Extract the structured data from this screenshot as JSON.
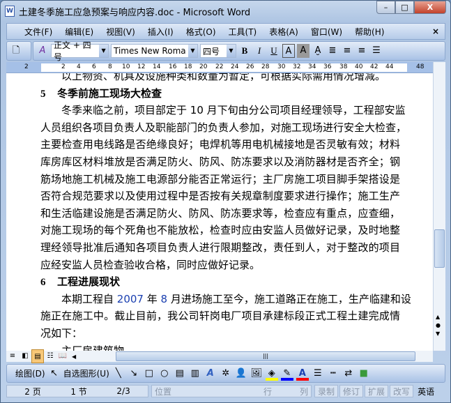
{
  "window": {
    "title": "土建冬季施工应急预案与响应内容.doc - Microsoft Word",
    "app_icon": "W",
    "minimize": "–",
    "maximize": "□",
    "close": "X"
  },
  "menu": {
    "items": [
      "文件(F)",
      "编辑(E)",
      "视图(V)",
      "插入(I)",
      "格式(O)",
      "工具(T)",
      "表格(A)",
      "窗口(W)",
      "帮助(H)"
    ],
    "close": "×"
  },
  "format_toolbar": {
    "style": "正文 + 四号",
    "font": "Times New Roma",
    "size": "四号",
    "bold": "B",
    "italic": "I",
    "underline": "U"
  },
  "ruler": {
    "ticks": [
      "2",
      "2",
      "4",
      "6",
      "8",
      "10",
      "12",
      "14",
      "16",
      "18",
      "20",
      "22",
      "24",
      "26",
      "28",
      "30",
      "32",
      "34",
      "36",
      "38",
      "40",
      "42",
      "44",
      "48"
    ]
  },
  "document": {
    "lines": [
      {
        "text": "以上物资、机具及设施种类和数量为暂定，可根据实际需用情况增减。",
        "type": "partial"
      },
      {
        "num": "5",
        "text": "冬季前施工现场大检查",
        "type": "heading"
      },
      {
        "text": "　　冬季来临之前，项目部定于 10 月下旬由分公司项目经理领导，工程部安监"
      },
      {
        "text": "人员组织各项目负责人及职能部门的负责人参加，对施工现场进行安全大检查，"
      },
      {
        "text": "主要检查用电线路是否绝缘良好；电焊机等用电机械接地是否灵敏有效；材料"
      },
      {
        "text": "库房库区材料堆放是否满足防火、防风、防冻要求以及消防器材是否齐全；钢"
      },
      {
        "text": "筋场地施工机械及施工电源部分能否正常运行；主厂房施工项目脚手架搭设是"
      },
      {
        "text": "否符合规范要求以及使用过程中是否按有关规章制度要求进行操作；施工生产"
      },
      {
        "text": "和生活临建设施是否满足防火、防风、防冻要求等，检查应有重点，应查细，"
      },
      {
        "text": "对施工现场的每个死角也不能放松，检查时应由安监人员做好记录，及时地整"
      },
      {
        "text": "理经领导批准后通知各项目负责人进行限期整改，责任到人，对于整改的项目"
      },
      {
        "text": "应经安监人员检查验收合格，同时应做好记录。",
        "type": "last"
      },
      {
        "num": "6",
        "text": "工程进展现状",
        "type": "heading"
      },
      {
        "pre": "　　本期工程自 ",
        "year": "2007",
        "mid": " 年 ",
        "month": "8",
        "post": " 月进场施工至今，施工道路正在施工，生产临建和设",
        "type": "mixed"
      },
      {
        "text": "施正在施工中。截止目前，我公司轩岗电厂项目承建标段正式工程土建完成情"
      },
      {
        "text": "况如下：",
        "type": "last"
      },
      {
        "text": "　　主厂房建筑物",
        "type": "last"
      }
    ]
  },
  "drawing_toolbar": {
    "draw": "绘图(D)",
    "autoshapes": "自选图形(U)"
  },
  "status": {
    "page": "2 页",
    "section": "1 节",
    "pages": "2/3",
    "position": "位置",
    "line": "行",
    "col": "列",
    "rec": "录制",
    "trk": "修订",
    "ext": "扩展",
    "ovr": "改写",
    "lang": "英语"
  },
  "colors": {
    "fill": "#ffff00",
    "line": "#0000ff",
    "font": "#ff0000"
  }
}
